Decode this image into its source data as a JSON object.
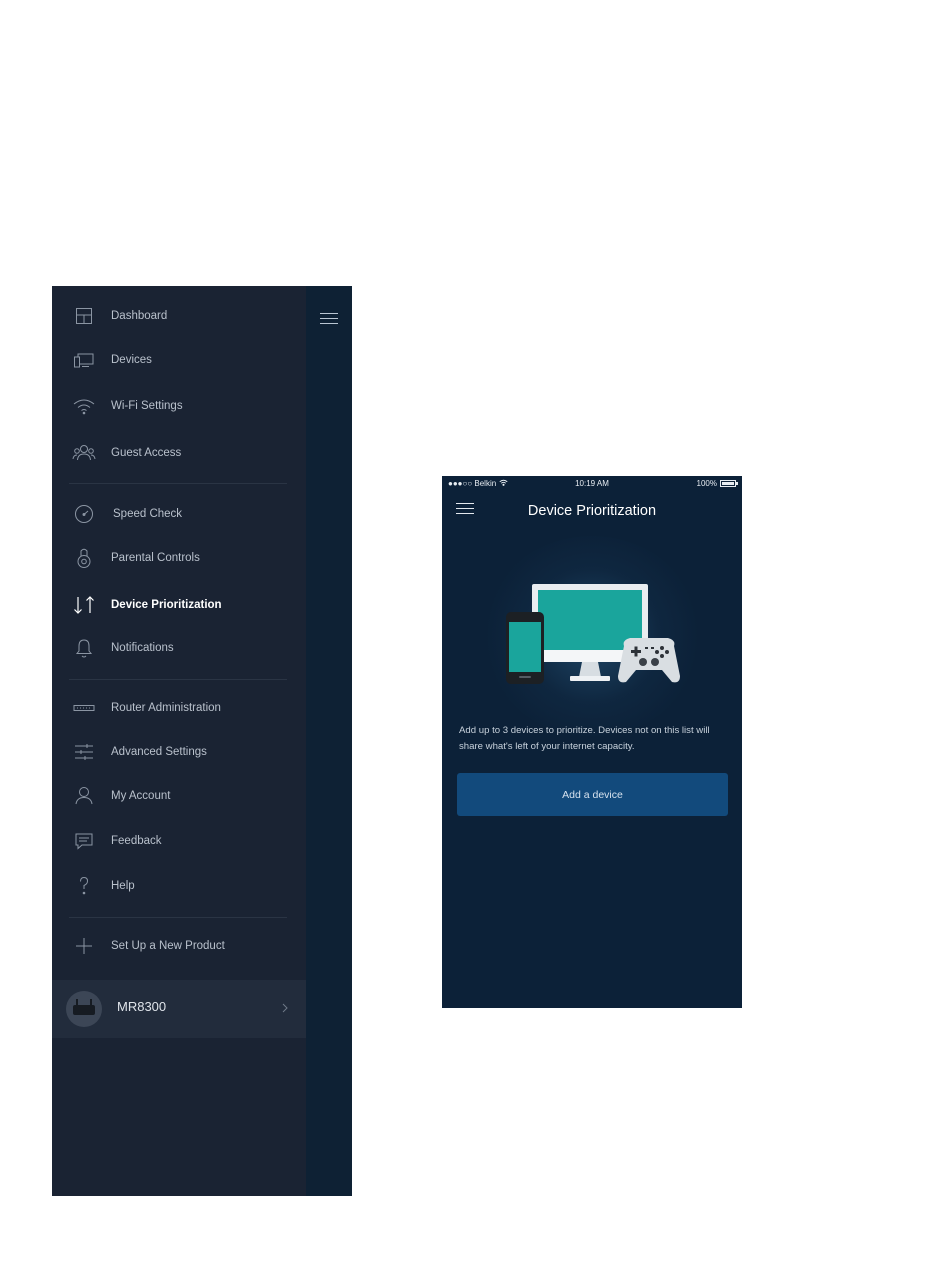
{
  "menu": {
    "items": [
      {
        "id": "dashboard",
        "label": "Dashboard",
        "icon": "dashboard-icon"
      },
      {
        "id": "devices",
        "label": "Devices",
        "icon": "devices-icon"
      },
      {
        "id": "wifi-settings",
        "label": "Wi-Fi Settings",
        "icon": "wifi-icon"
      },
      {
        "id": "guest-access",
        "label": "Guest Access",
        "icon": "guest-users-icon"
      },
      {
        "id": "speed-check",
        "label": "Speed Check",
        "icon": "speedometer-icon"
      },
      {
        "id": "parental-controls",
        "label": "Parental Controls",
        "icon": "lock-icon"
      },
      {
        "id": "device-prioritization",
        "label": "Device Prioritization",
        "icon": "up-down-arrows-icon",
        "active": true
      },
      {
        "id": "notifications",
        "label": "Notifications",
        "icon": "bell-icon"
      },
      {
        "id": "router-administration",
        "label": "Router Administration",
        "icon": "router-icon"
      },
      {
        "id": "advanced-settings",
        "label": "Advanced Settings",
        "icon": "sliders-icon"
      },
      {
        "id": "my-account",
        "label": "My Account",
        "icon": "user-icon"
      },
      {
        "id": "feedback",
        "label": "Feedback",
        "icon": "chat-bubble-icon"
      },
      {
        "id": "help",
        "label": "Help",
        "icon": "question-mark-icon"
      },
      {
        "id": "setup-new-product",
        "label": "Set Up a New Product",
        "icon": "plus-icon"
      }
    ],
    "device": {
      "name": "MR8300",
      "icon": "router-avatar-icon"
    }
  },
  "status_bar": {
    "carrier": "●●●○○ Belkin",
    "time": "10:19 AM",
    "battery": "100%"
  },
  "screen": {
    "title": "Device Prioritization",
    "description": "Add up to 3 devices to prioritize. Devices not on this list will share what's left of your internet capacity.",
    "add_button_label": "Add a device"
  },
  "colors": {
    "menu_bg": "#1a2333",
    "screen_bg": "#0c2138",
    "button_bg": "#124a7c",
    "accent_teal": "#1aa59c"
  }
}
